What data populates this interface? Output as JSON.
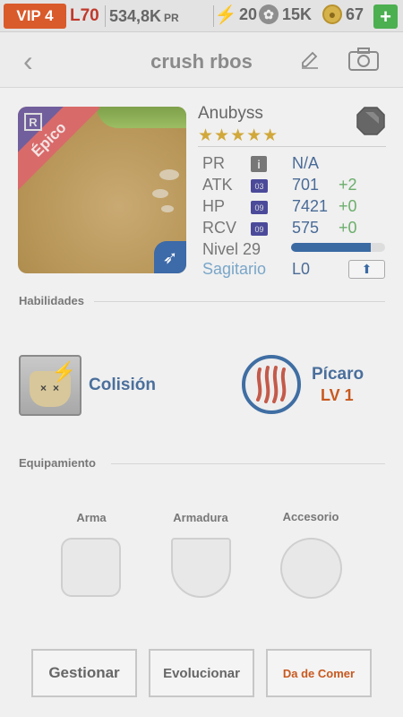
{
  "topbar": {
    "vip": "VIP 4",
    "level": "L70",
    "power": "534,8K",
    "power_unit": "PR",
    "energy": "20",
    "paws": "15K",
    "coins": "67",
    "add_label": "+"
  },
  "header": {
    "back_label": "‹",
    "title": "crush rbos"
  },
  "hero": {
    "name": "Anubyss",
    "stars": "★★★★★",
    "rarity": "Épico",
    "rarity_badge": "R",
    "stats": [
      {
        "label": "PR",
        "badge": "i",
        "value": "N/A",
        "bonus": ""
      },
      {
        "label": "ATK",
        "badge": "03",
        "value": "701",
        "bonus": "+2"
      },
      {
        "label": "HP",
        "badge": "09",
        "value": "7421",
        "bonus": "+0"
      },
      {
        "label": "RCV",
        "badge": "09",
        "value": "575",
        "bonus": "+0"
      }
    ],
    "level_label": "Nivel 29",
    "level_progress": 0.85,
    "sign": "Sagitario",
    "sign_level": "L0",
    "upgrade_icon": "⬆"
  },
  "skills": {
    "section_title": "Habilidades",
    "active_name": "Colisión",
    "leader_name": "Pícaro",
    "leader_level": "LV 1"
  },
  "equipment": {
    "section_title": "Equipamiento",
    "slots": [
      "Arma",
      "Armadura",
      "Accesorio"
    ]
  },
  "actions": {
    "manage": "Gestionar",
    "evolve": "Evolucionar",
    "feed": "Da de Comer"
  },
  "colors": {
    "accent_blue": "#3b6aa3",
    "vip_orange": "#d95a2b",
    "bonus_green": "#6cae6c",
    "feed_orange": "#c8591f"
  },
  "icons": [
    "energy-icon",
    "paw-icon",
    "coin-icon",
    "plus-icon",
    "back-icon",
    "edit-icon",
    "camera-icon",
    "element-gem-icon",
    "archer-class-icon",
    "info-icon",
    "upgrade-arrow-icon",
    "lightning-icon",
    "claw-icon"
  ]
}
